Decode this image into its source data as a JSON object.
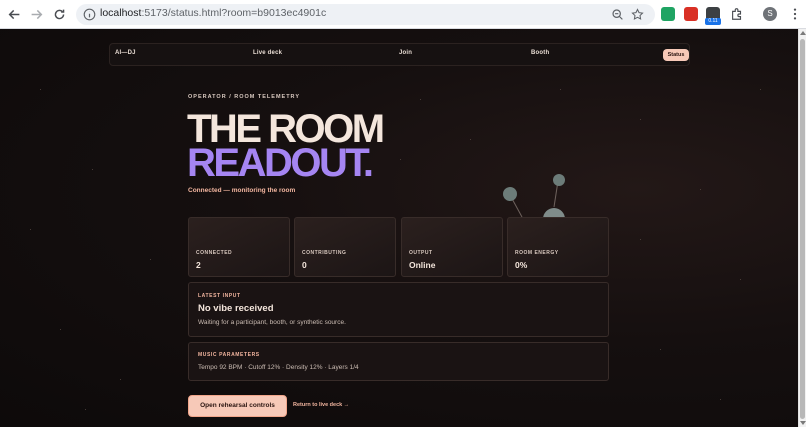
{
  "browser": {
    "url_host": "localhost",
    "url_path": ":5173/status.html?room=b9013ec4901c",
    "ext_badge": "0.11",
    "profile_initial": "S"
  },
  "nav": {
    "brand": "AI—DJ",
    "live_deck": "Live deck",
    "join": "Join",
    "booth": "Booth",
    "status": "Status"
  },
  "hero": {
    "eyebrow": "OPERATOR / ROOM TELEMETRY",
    "title_line1": "THE ROOM",
    "title_line2": "READOUT.",
    "connection_status": "Connected — monitoring the room"
  },
  "stats": [
    {
      "label": "CONNECTED",
      "value": "2"
    },
    {
      "label": "CONTRIBUTING",
      "value": "0"
    },
    {
      "label": "OUTPUT",
      "value": "Online"
    },
    {
      "label": "ROOM ENERGY",
      "value": "0%"
    }
  ],
  "latest_input": {
    "label": "LATEST INPUT",
    "title": "No vibe received",
    "description": "Waiting for a participant, booth, or synthetic source."
  },
  "music_parameters": {
    "label": "MUSIC PARAMETERS",
    "summary": "Tempo 92 BPM · Cutoff 12% · Density 12% · Layers 1/4"
  },
  "actions": {
    "primary": "Open rehearsal controls",
    "secondary": "Return to live deck →"
  },
  "colors": {
    "accent_peach": "#f7c9b8",
    "accent_violet": "#a585f2",
    "background": "#0f0c0c"
  }
}
